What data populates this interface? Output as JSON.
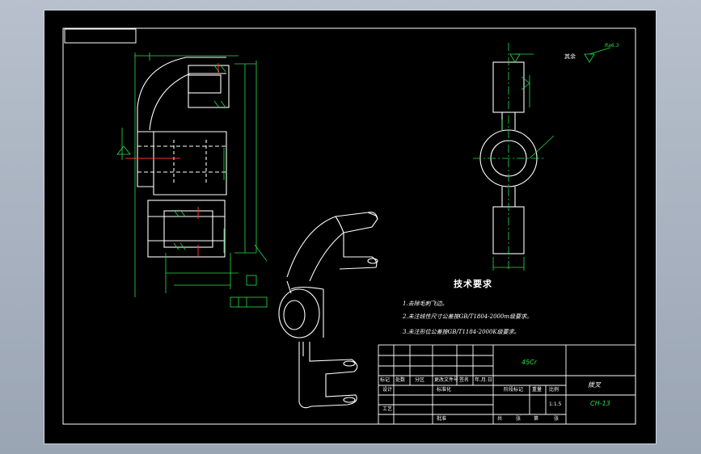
{
  "notes": {
    "title": "技术要求",
    "items": [
      "1.去除毛刺飞边。",
      "2.未注线性尺寸公差按GB/T1804-2000m级要求。",
      "3.未注形位公差按GB/T1184-2000K级要求。"
    ]
  },
  "title_block": {
    "material": "45Cr",
    "part_name": "拨叉",
    "drawing_no": "CH-13",
    "scale": "1:1.5",
    "row_labels": [
      "标记",
      "处数",
      "分区",
      "更改文件号",
      "签名",
      "年.月.日"
    ],
    "design_label": "设计",
    "std_label": "标准化",
    "stage_label": "阶段标记",
    "weight_label": "重量",
    "scale_label": "比例",
    "process_label": "工艺",
    "approve_label": "批准",
    "sheet_info": [
      "共",
      "张",
      "第",
      "张"
    ]
  },
  "roughness": {
    "other": "其余",
    "value": "Ra6.3"
  }
}
